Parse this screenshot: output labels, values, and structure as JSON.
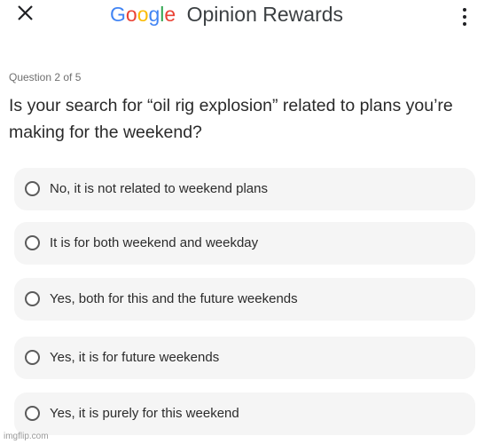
{
  "header": {
    "close_icon": "close-icon",
    "brand_letters": [
      {
        "char": "G",
        "color": "#4285F4"
      },
      {
        "char": "o",
        "color": "#EA4335"
      },
      {
        "char": "o",
        "color": "#FBBC05"
      },
      {
        "char": "g",
        "color": "#4285F4"
      },
      {
        "char": "l",
        "color": "#34A853"
      },
      {
        "char": "e",
        "color": "#EA4335"
      }
    ],
    "app_name": "Opinion Rewards",
    "menu_icon": "more-vert-icon"
  },
  "survey": {
    "counter": "Question 2 of 5",
    "question": "Is your search for “oil rig explosion” related to plans you’re making for the weekend?",
    "options": [
      {
        "label": "No, it is not related to weekend plans"
      },
      {
        "label": "It is for both weekend and weekday"
      },
      {
        "label": "Yes, both for this and the future weekends"
      },
      {
        "label": "Yes, it is for future weekends"
      },
      {
        "label": "Yes, it is purely for this weekend"
      }
    ]
  },
  "watermark": "imgflip.com"
}
